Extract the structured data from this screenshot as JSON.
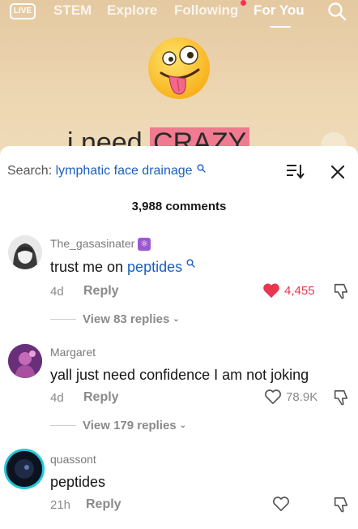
{
  "nav": {
    "live_label": "LIVE",
    "tabs": [
      {
        "label": "STEM"
      },
      {
        "label": "Explore"
      },
      {
        "label": "Following"
      },
      {
        "label": "For You"
      }
    ],
    "active_tab": "For You"
  },
  "video": {
    "caption_plain": "i need",
    "caption_highlight": "CRAZY"
  },
  "comments_sheet": {
    "search_label": "Search:",
    "search_query": "lymphatic face drainage",
    "count_text": "3,988 comments",
    "comments": [
      {
        "username": "The_gasasinater",
        "text": "trust me on ",
        "link_text": "peptides",
        "age": "4d",
        "reply_label": "Reply",
        "likes": "4,455",
        "liked": true,
        "view_replies": "View 83 replies"
      },
      {
        "username": "Margaret",
        "text": "yall just need confidence I am not joking",
        "age": "4d",
        "reply_label": "Reply",
        "likes": "78.9K",
        "liked": false,
        "view_replies": "View 179 replies"
      },
      {
        "username": "quassont",
        "text": "peptides",
        "age": "21h",
        "reply_label": "Reply",
        "likes": "",
        "liked": false
      }
    ]
  },
  "colors": {
    "accent_link": "#1c5fbf",
    "like_red": "#e8364f",
    "highlight": "#f07a8f"
  }
}
